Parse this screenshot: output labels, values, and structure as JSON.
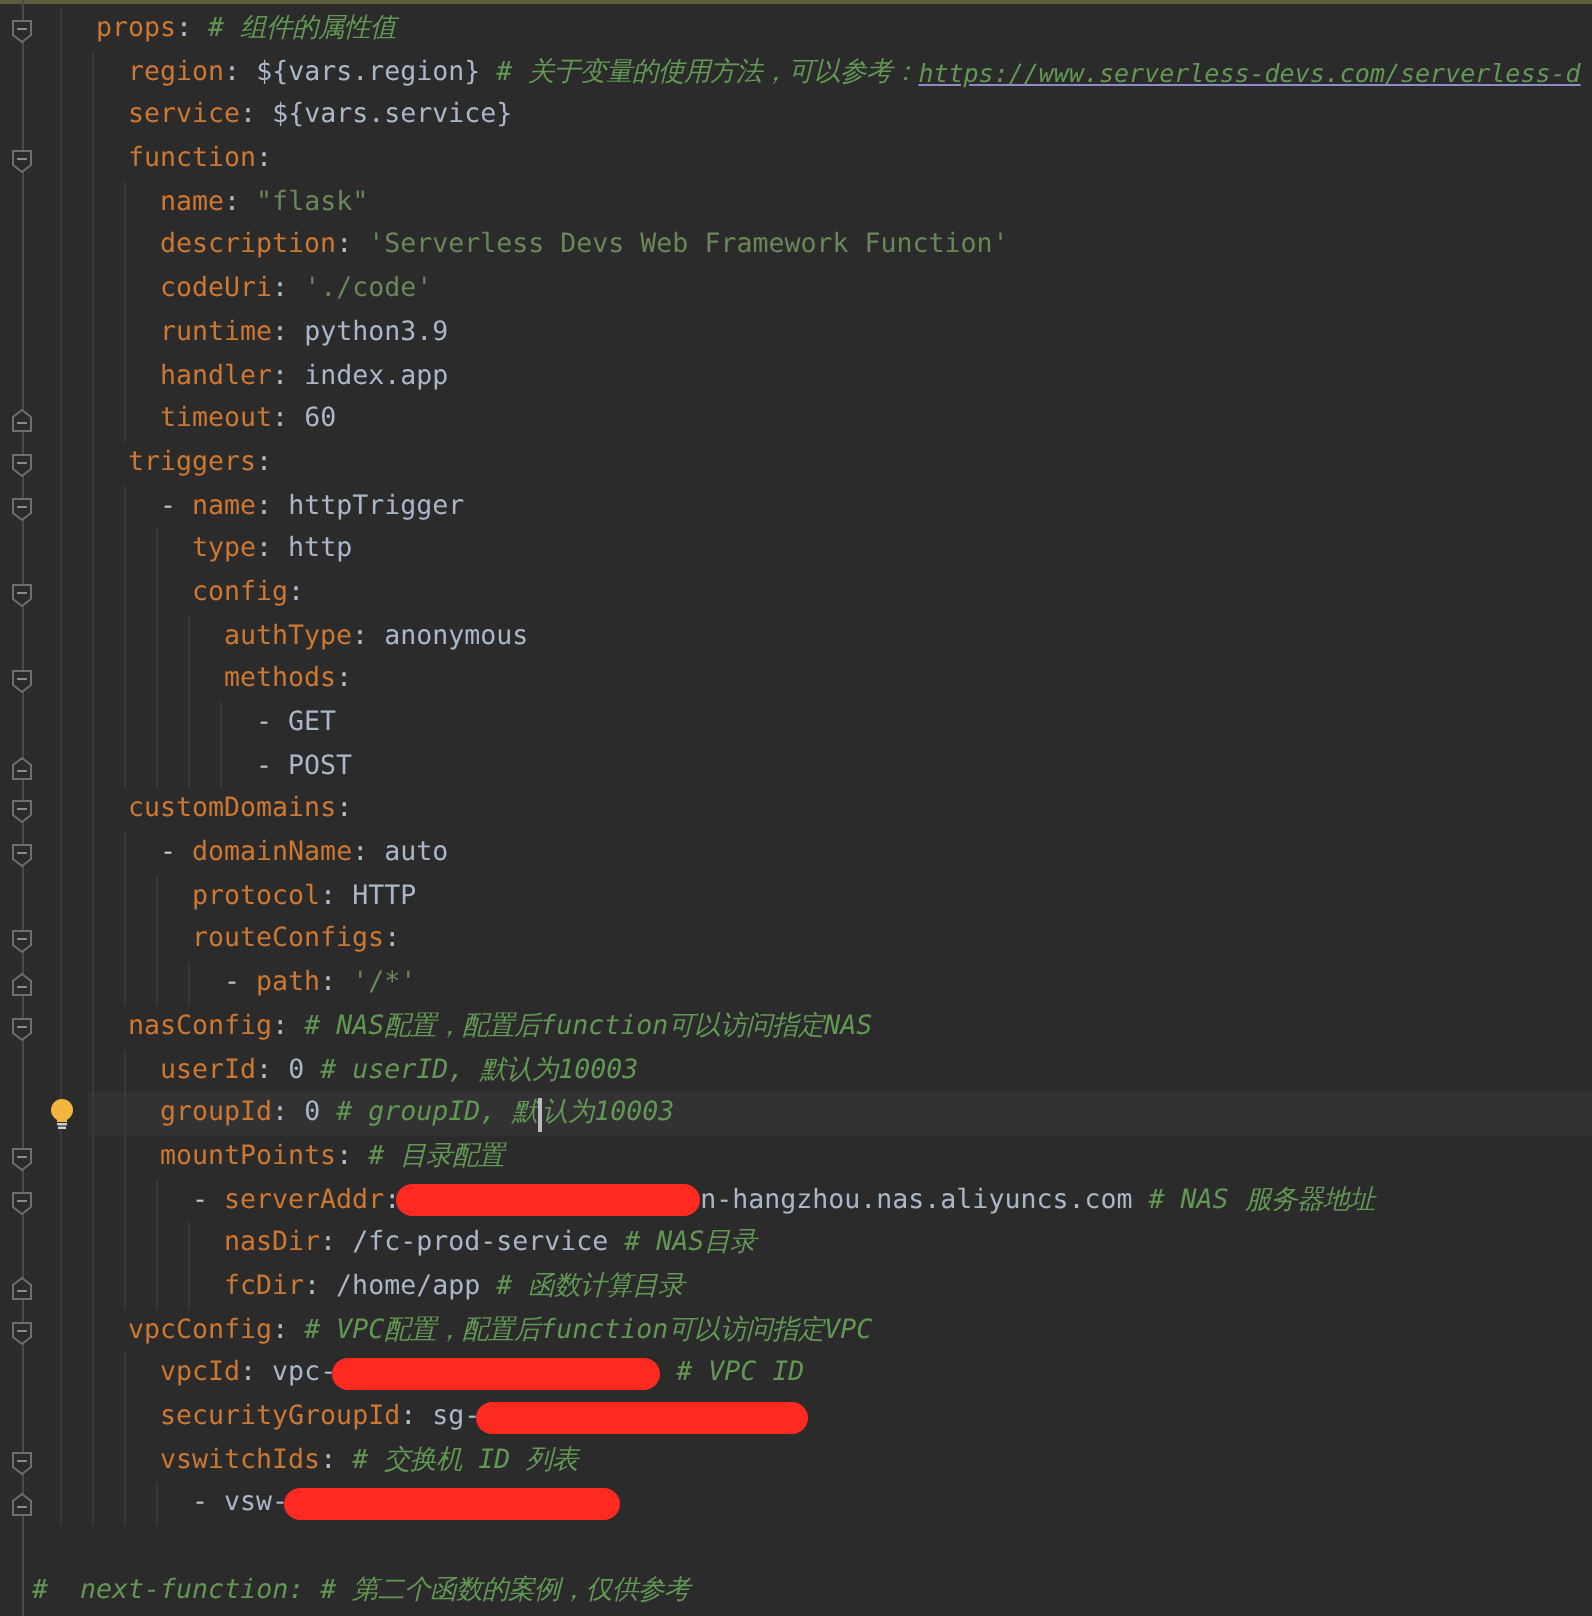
{
  "lines": [
    {
      "kind": "code",
      "current": false,
      "tokens": [
        {
          "kind": "key",
          "text": "props"
        },
        {
          "kind": "punct",
          "text": ":"
        },
        {
          "kind": "comment",
          "text": " # 组件的属性值"
        }
      ],
      "children": [
        {
          "kind": "code",
          "current": false,
          "tokens": [
            {
              "kind": "key",
              "text": "region"
            },
            {
              "kind": "punct",
              "text": ":"
            },
            {
              "kind": "value",
              "text": " ${vars.region}"
            },
            {
              "kind": "comment",
              "text": " # 关于变量的使用方法，可以参考："
            },
            {
              "kind": "link",
              "text": "https://www.serverless-devs.com/serverless-d"
            }
          ]
        },
        {
          "kind": "code",
          "current": false,
          "tokens": [
            {
              "kind": "key",
              "text": "service"
            },
            {
              "kind": "punct",
              "text": ":"
            },
            {
              "kind": "value",
              "text": " ${vars.service}"
            }
          ]
        },
        {
          "kind": "code",
          "current": false,
          "tokens": [
            {
              "kind": "key",
              "text": "function"
            },
            {
              "kind": "punct",
              "text": ":"
            }
          ],
          "children": [
            {
              "kind": "code",
              "current": false,
              "tokens": [
                {
                  "kind": "key",
                  "text": "name"
                },
                {
                  "kind": "punct",
                  "text": ":"
                },
                {
                  "kind": "string",
                  "text": " \"flask\""
                }
              ]
            },
            {
              "kind": "code",
              "current": false,
              "tokens": [
                {
                  "kind": "key",
                  "text": "description"
                },
                {
                  "kind": "punct",
                  "text": ":"
                },
                {
                  "kind": "string",
                  "text": " 'Serverless Devs Web Framework Function'"
                }
              ]
            },
            {
              "kind": "code",
              "current": false,
              "tokens": [
                {
                  "kind": "key",
                  "text": "codeUri"
                },
                {
                  "kind": "punct",
                  "text": ":"
                },
                {
                  "kind": "string",
                  "text": " './code'"
                }
              ]
            },
            {
              "kind": "code",
              "current": false,
              "tokens": [
                {
                  "kind": "key",
                  "text": "runtime"
                },
                {
                  "kind": "punct",
                  "text": ":"
                },
                {
                  "kind": "value",
                  "text": " python3.9"
                }
              ]
            },
            {
              "kind": "code",
              "current": false,
              "tokens": [
                {
                  "kind": "key",
                  "text": "handler"
                },
                {
                  "kind": "punct",
                  "text": ":"
                },
                {
                  "kind": "value",
                  "text": " index.app"
                }
              ]
            },
            {
              "kind": "code",
              "current": false,
              "tokens": [
                {
                  "kind": "key",
                  "text": "timeout"
                },
                {
                  "kind": "punct",
                  "text": ":"
                },
                {
                  "kind": "value",
                  "text": " 60"
                }
              ]
            }
          ]
        },
        {
          "kind": "code",
          "current": false,
          "tokens": [
            {
              "kind": "key",
              "text": "triggers"
            },
            {
              "kind": "punct",
              "text": ":"
            }
          ],
          "children": [
            {
              "kind": "code",
              "current": false,
              "tokens": [
                {
                  "kind": "dash",
                  "text": "- "
                },
                {
                  "kind": "key",
                  "text": "name"
                },
                {
                  "kind": "punct",
                  "text": ":"
                },
                {
                  "kind": "value",
                  "text": " httpTrigger"
                }
              ],
              "children": [
                {
                  "kind": "code",
                  "current": false,
                  "tokens": [
                    {
                      "kind": "key",
                      "text": "type"
                    },
                    {
                      "kind": "punct",
                      "text": ":"
                    },
                    {
                      "kind": "value",
                      "text": " http"
                    }
                  ]
                },
                {
                  "kind": "code",
                  "current": false,
                  "tokens": [
                    {
                      "kind": "key",
                      "text": "config"
                    },
                    {
                      "kind": "punct",
                      "text": ":"
                    }
                  ],
                  "children": [
                    {
                      "kind": "code",
                      "current": false,
                      "tokens": [
                        {
                          "kind": "key",
                          "text": "authType"
                        },
                        {
                          "kind": "punct",
                          "text": ":"
                        },
                        {
                          "kind": "value",
                          "text": " anonymous"
                        }
                      ]
                    },
                    {
                      "kind": "code",
                      "current": false,
                      "tokens": [
                        {
                          "kind": "key",
                          "text": "methods"
                        },
                        {
                          "kind": "punct",
                          "text": ":"
                        }
                      ],
                      "children": [
                        {
                          "kind": "code",
                          "current": false,
                          "tokens": [
                            {
                              "kind": "dash",
                              "text": "- "
                            },
                            {
                              "kind": "value",
                              "text": "GET"
                            }
                          ]
                        },
                        {
                          "kind": "code",
                          "current": false,
                          "tokens": [
                            {
                              "kind": "dash",
                              "text": "- "
                            },
                            {
                              "kind": "value",
                              "text": "POST"
                            }
                          ]
                        }
                      ]
                    }
                  ]
                }
              ]
            }
          ]
        },
        {
          "kind": "code",
          "current": false,
          "tokens": [
            {
              "kind": "key",
              "text": "customDomains"
            },
            {
              "kind": "punct",
              "text": ":"
            }
          ],
          "children": [
            {
              "kind": "code",
              "current": false,
              "tokens": [
                {
                  "kind": "dash",
                  "text": "- "
                },
                {
                  "kind": "key",
                  "text": "domainName"
                },
                {
                  "kind": "punct",
                  "text": ":"
                },
                {
                  "kind": "value",
                  "text": " auto"
                }
              ],
              "children": [
                {
                  "kind": "code",
                  "current": false,
                  "tokens": [
                    {
                      "kind": "key",
                      "text": "protocol"
                    },
                    {
                      "kind": "punct",
                      "text": ":"
                    },
                    {
                      "kind": "value",
                      "text": " HTTP"
                    }
                  ]
                },
                {
                  "kind": "code",
                  "current": false,
                  "tokens": [
                    {
                      "kind": "key",
                      "text": "routeConfigs"
                    },
                    {
                      "kind": "punct",
                      "text": ":"
                    }
                  ],
                  "children": [
                    {
                      "kind": "code",
                      "current": false,
                      "tokens": [
                        {
                          "kind": "dash",
                          "text": "- "
                        },
                        {
                          "kind": "key",
                          "text": "path"
                        },
                        {
                          "kind": "punct",
                          "text": ":"
                        },
                        {
                          "kind": "string",
                          "text": " '/*'"
                        }
                      ]
                    }
                  ]
                }
              ]
            }
          ]
        },
        {
          "kind": "code",
          "current": false,
          "tokens": [
            {
              "kind": "key",
              "text": "nasConfig"
            },
            {
              "kind": "punct",
              "text": ":"
            },
            {
              "kind": "comment",
              "text": " # NAS配置，配置后function可以访问指定NAS"
            }
          ],
          "children": [
            {
              "kind": "code",
              "current": false,
              "tokens": [
                {
                  "kind": "key",
                  "text": "userId"
                },
                {
                  "kind": "punct",
                  "text": ":"
                },
                {
                  "kind": "value",
                  "text": " 0"
                },
                {
                  "kind": "comment",
                  "text": " # userID, 默认为10003"
                }
              ]
            },
            {
              "kind": "code",
              "current": true,
              "tokens": [
                {
                  "kind": "key",
                  "text": "groupId"
                },
                {
                  "kind": "punct",
                  "text": ":"
                },
                {
                  "kind": "value",
                  "text": " 0"
                },
                {
                  "kind": "comment",
                  "text": " # groupID, 默"
                },
                {
                  "kind": "caret"
                },
                {
                  "kind": "comment",
                  "text": "认为10003"
                }
              ]
            },
            {
              "kind": "code",
              "current": false,
              "tokens": [
                {
                  "kind": "key",
                  "text": "mountPoints"
                },
                {
                  "kind": "punct",
                  "text": ":"
                },
                {
                  "kind": "comment",
                  "text": " # 目录配置"
                }
              ],
              "children": [
                {
                  "kind": "code",
                  "current": false,
                  "tokens": [
                    {
                      "kind": "dash",
                      "text": "- "
                    },
                    {
                      "kind": "key",
                      "text": "serverAddr"
                    },
                    {
                      "kind": "punct",
                      "text": ":"
                    },
                    {
                      "kind": "redaction"
                    },
                    {
                      "kind": "value",
                      "text": "n-hangzhou.nas.aliyuncs.com"
                    },
                    {
                      "kind": "comment",
                      "text": " # NAS 服务器地址"
                    }
                  ],
                  "children": [
                    {
                      "kind": "code",
                      "current": false,
                      "tokens": [
                        {
                          "kind": "key",
                          "text": "nasDir"
                        },
                        {
                          "kind": "punct",
                          "text": ":"
                        },
                        {
                          "kind": "value",
                          "text": " /fc-prod-service"
                        },
                        {
                          "kind": "comment",
                          "text": " # NAS目录"
                        }
                      ]
                    },
                    {
                      "kind": "code",
                      "current": false,
                      "tokens": [
                        {
                          "kind": "key",
                          "text": "fcDir"
                        },
                        {
                          "kind": "punct",
                          "text": ":"
                        },
                        {
                          "kind": "value",
                          "text": " /home/app"
                        },
                        {
                          "kind": "comment",
                          "text": " # 函数计算目录"
                        }
                      ]
                    }
                  ]
                }
              ]
            }
          ]
        },
        {
          "kind": "code",
          "current": false,
          "tokens": [
            {
              "kind": "key",
              "text": "vpcConfig"
            },
            {
              "kind": "punct",
              "text": ":"
            },
            {
              "kind": "comment",
              "text": " # VPC配置，配置后function可以访问指定VPC"
            }
          ],
          "children": [
            {
              "kind": "code",
              "current": false,
              "tokens": [
                {
                  "kind": "key",
                  "text": "vpcId"
                },
                {
                  "kind": "punct",
                  "text": ":"
                },
                {
                  "kind": "value",
                  "text": " vpc-"
                },
                {
                  "kind": "redaction"
                },
                {
                  "kind": "comment",
                  "text": " # VPC ID"
                }
              ]
            },
            {
              "kind": "code",
              "current": false,
              "tokens": [
                {
                  "kind": "key",
                  "text": "securityGroupId"
                },
                {
                  "kind": "punct",
                  "text": ":"
                },
                {
                  "kind": "value",
                  "text": " sg-"
                },
                {
                  "kind": "redaction"
                }
              ]
            },
            {
              "kind": "code",
              "current": false,
              "tokens": [
                {
                  "kind": "key",
                  "text": "vswitchIds"
                },
                {
                  "kind": "punct",
                  "text": ":"
                },
                {
                  "kind": "comment",
                  "text": " # 交换机 ID 列表"
                }
              ],
              "children": [
                {
                  "kind": "code",
                  "current": false,
                  "tokens": [
                    {
                      "kind": "dash",
                      "text": "- "
                    },
                    {
                      "kind": "value",
                      "text": "vsw-"
                    },
                    {
                      "kind": "redaction"
                    }
                  ]
                }
              ]
            }
          ]
        }
      ]
    },
    {
      "kind": "blank",
      "current": false
    },
    {
      "kind": "file_comment",
      "current": false,
      "tokens": [
        {
          "kind": "comment",
          "text": "#  next-function: # 第二个函数的案例，仅供参考"
        }
      ]
    }
  ]
}
